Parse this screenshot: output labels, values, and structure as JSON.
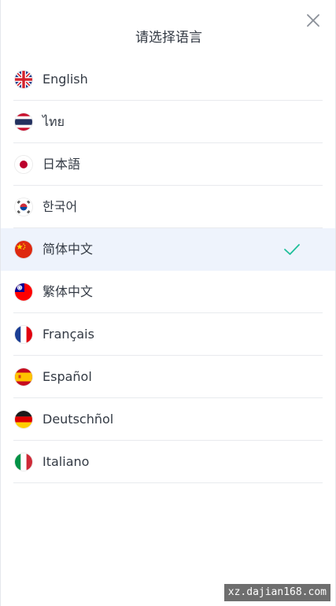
{
  "dialog": {
    "title": "请选择语言"
  },
  "languages": [
    {
      "label": "English",
      "flag": "uk-flag-icon",
      "selected": false
    },
    {
      "label": "ไทย",
      "flag": "thailand-flag-icon",
      "selected": false
    },
    {
      "label": "日本語",
      "flag": "japan-flag-icon",
      "selected": false
    },
    {
      "label": "한국어",
      "flag": "korea-flag-icon",
      "selected": false
    },
    {
      "label": "简体中文",
      "flag": "china-flag-icon",
      "selected": true
    },
    {
      "label": "繁体中文",
      "flag": "taiwan-flag-icon",
      "selected": false
    },
    {
      "label": "Français",
      "flag": "france-flag-icon",
      "selected": false
    },
    {
      "label": "Español",
      "flag": "spain-flag-icon",
      "selected": false
    },
    {
      "label": "Deutschñol",
      "flag": "germany-flag-icon",
      "selected": false
    },
    {
      "label": "Italiano",
      "flag": "italy-flag-icon",
      "selected": false
    }
  ],
  "colors": {
    "selected_background": "#eef3fc",
    "check_color": "#1fbf9a"
  },
  "watermark": "xz.dajian168.com"
}
